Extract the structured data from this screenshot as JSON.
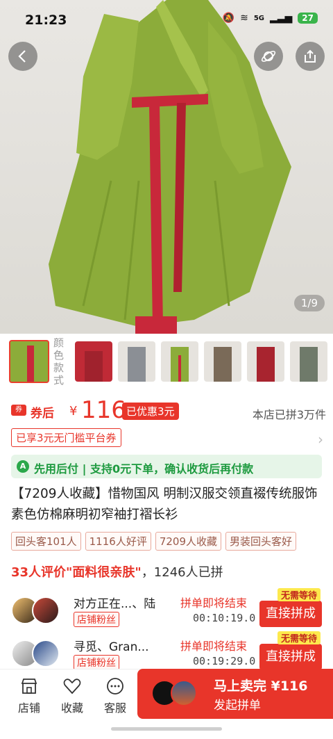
{
  "status_bar": {
    "time": "21:23",
    "network": "5G",
    "battery": "27"
  },
  "hero": {
    "pager": "1/9"
  },
  "thumbs": {
    "label": "颜色\n款式",
    "label_l1": "颜色",
    "label_l2": "款式"
  },
  "price": {
    "after_label": "券后",
    "yen": "¥",
    "amount": "116",
    "discount": "已优惠3元",
    "store_sold": "本店已拼3万件"
  },
  "coupon_line": "已享3元无门槛平台券",
  "pay_later": {
    "icon_letter": "A",
    "text": "先用后付 | 支持0元下单，确认收货后再付款"
  },
  "title": "【7209人收藏】惜物国风 明制汉服交领直裰传统服饰素色仿棉麻明初窄袖打褶长衫",
  "tags": [
    "回头客101人",
    "1116人好评",
    "7209人收藏",
    "男装回头客好"
  ],
  "review": {
    "highlight": "33人评价\"面料很亲肤\"",
    "rest": "，1246人已拼"
  },
  "groups": [
    {
      "name": "对方正在...、陆",
      "badge": "店铺粉丝",
      "ending": "拼单即将结束",
      "timer": "00:10:19.0",
      "tag": "无需等待",
      "button": "直接拼成"
    },
    {
      "name": "寻觅、Gran...",
      "badge": "店铺粉丝",
      "ending": "拼单即将结束",
      "timer": "00:19:29.0",
      "tag": "无需等待",
      "button": "直接拼成"
    }
  ],
  "bottom": {
    "store": "店铺",
    "favorite": "收藏",
    "service": "客服",
    "buy_line1": "马上卖完 ¥116",
    "buy_line2": "发起拼单"
  },
  "colors": {
    "accent": "#e8352a",
    "green": "#1d9a3f",
    "robe": "#8cac3a",
    "sash": "#c8283a"
  }
}
